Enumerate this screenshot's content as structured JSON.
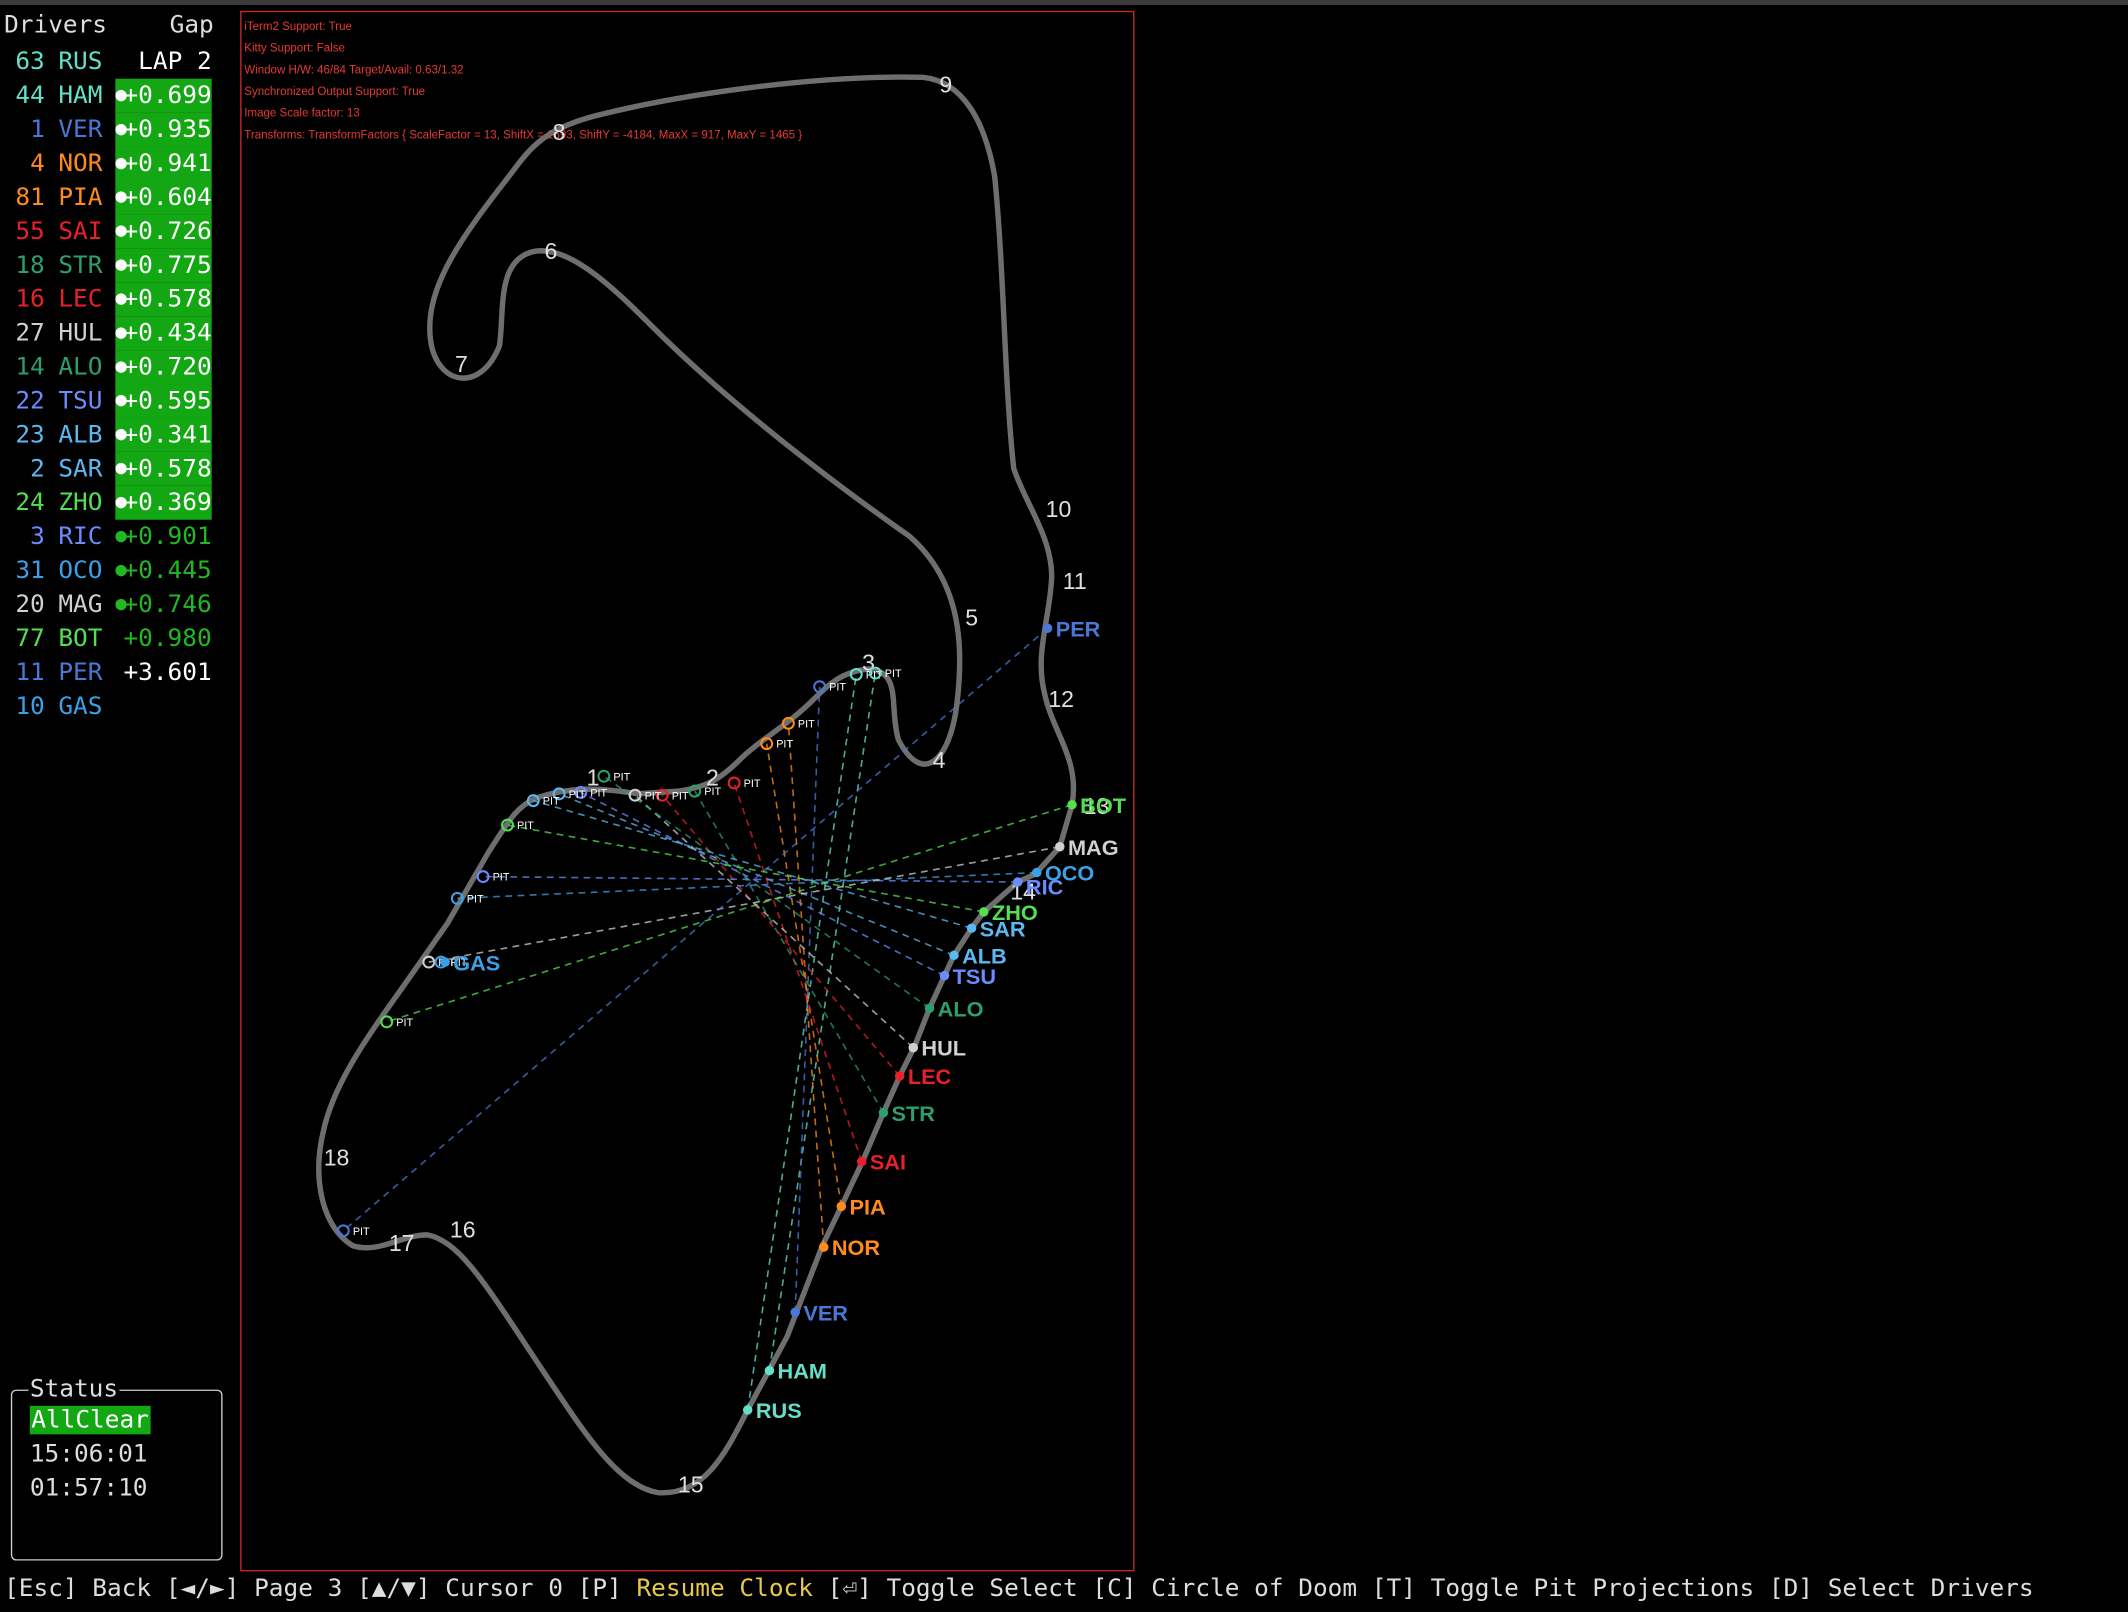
{
  "header": {
    "drivers": "Drivers",
    "gap": "Gap"
  },
  "drivers": [
    {
      "num": "63",
      "code": "RUS",
      "color": "#64e0c8",
      "gap": "LAP 2",
      "gap_style": "plain"
    },
    {
      "num": "44",
      "code": "HAM",
      "color": "#64e0c8",
      "gap": "+0.699",
      "gap_style": "green"
    },
    {
      "num": "1",
      "code": "VER",
      "color": "#4a78d6",
      "gap": "+0.935",
      "gap_style": "green"
    },
    {
      "num": "4",
      "code": "NOR",
      "color": "#ff8c1a",
      "gap": "+0.941",
      "gap_style": "green"
    },
    {
      "num": "81",
      "code": "PIA",
      "color": "#ff8c1a",
      "gap": "+0.604",
      "gap_style": "green"
    },
    {
      "num": "55",
      "code": "SAI",
      "color": "#e8202a",
      "gap": "+0.726",
      "gap_style": "green"
    },
    {
      "num": "18",
      "code": "STR",
      "color": "#2e9e6e",
      "gap": "+0.775",
      "gap_style": "green"
    },
    {
      "num": "16",
      "code": "LEC",
      "color": "#e8202a",
      "gap": "+0.578",
      "gap_style": "green"
    },
    {
      "num": "27",
      "code": "HUL",
      "color": "#d0d0d0",
      "gap": "+0.434",
      "gap_style": "green"
    },
    {
      "num": "14",
      "code": "ALO",
      "color": "#2e9e6e",
      "gap": "+0.720",
      "gap_style": "green"
    },
    {
      "num": "22",
      "code": "TSU",
      "color": "#6b8cff",
      "gap": "+0.595",
      "gap_style": "green"
    },
    {
      "num": "23",
      "code": "ALB",
      "color": "#5cb8f0",
      "gap": "+0.341",
      "gap_style": "green"
    },
    {
      "num": "2",
      "code": "SAR",
      "color": "#5cb8f0",
      "gap": "+0.578",
      "gap_style": "green"
    },
    {
      "num": "24",
      "code": "ZHO",
      "color": "#52e052",
      "gap": "+0.369",
      "gap_style": "green"
    },
    {
      "num": "3",
      "code": "RIC",
      "color": "#6b8cff",
      "gap": "+0.901",
      "gap_style": "dim"
    },
    {
      "num": "31",
      "code": "OCO",
      "color": "#3aa0e8",
      "gap": "+0.445",
      "gap_style": "dim"
    },
    {
      "num": "20",
      "code": "MAG",
      "color": "#d0d0d0",
      "gap": "+0.746",
      "gap_style": "dim"
    },
    {
      "num": "77",
      "code": "BOT",
      "color": "#52e052",
      "gap": "+0.980",
      "gap_style": "dimnodot"
    },
    {
      "num": "11",
      "code": "PER",
      "color": "#4a78d6",
      "gap": "+3.601",
      "gap_style": "plain"
    },
    {
      "num": "10",
      "code": "GAS",
      "color": "#3aa0e8",
      "gap": "",
      "gap_style": "plain"
    }
  ],
  "status": {
    "title": "Status",
    "state": "AllClear",
    "time1": "15:06:01",
    "time2": "01:57:10"
  },
  "debug_lines": [
    "iTerm2 Support: True",
    "Kitty Support: False",
    "Window H/W: 46/84 Target/Avail: 0.63/1.32",
    "Synchronized Output Support: True",
    "Image Scale factor: 13",
    "Transforms: TransformFactors { ScaleFactor = 13, ShiftX = 1693, ShiftY = -4184, MaxX = 917, MaxY = 1465 }"
  ],
  "map": {
    "track_color": "#6e6e6e",
    "pit_label": "PIT",
    "corners": [
      "1",
      "2",
      "3",
      "4",
      "5",
      "6",
      "7",
      "8",
      "9",
      "10",
      "11",
      "12",
      "13",
      "14",
      "15",
      "16",
      "17",
      "18"
    ],
    "cars": [
      {
        "code": "RUS",
        "color": "#64e0c8"
      },
      {
        "code": "HAM",
        "color": "#64e0c8"
      },
      {
        "code": "VER",
        "color": "#4a78d6"
      },
      {
        "code": "NOR",
        "color": "#ff8c1a"
      },
      {
        "code": "PIA",
        "color": "#ff8c1a"
      },
      {
        "code": "SAI",
        "color": "#e8202a"
      },
      {
        "code": "STR",
        "color": "#2e9e6e"
      },
      {
        "code": "LEC",
        "color": "#e8202a"
      },
      {
        "code": "HUL",
        "color": "#d0d0d0"
      },
      {
        "code": "ALO",
        "color": "#2e9e6e"
      },
      {
        "code": "TSU",
        "color": "#6b8cff"
      },
      {
        "code": "ALB",
        "color": "#5cb8f0"
      },
      {
        "code": "SAR",
        "color": "#5cb8f0"
      },
      {
        "code": "ZHO",
        "color": "#52e052"
      },
      {
        "code": "RIC",
        "color": "#6b8cff"
      },
      {
        "code": "OCO",
        "color": "#3aa0e8"
      },
      {
        "code": "MAG",
        "color": "#d0d0d0"
      },
      {
        "code": "BOT",
        "color": "#52e052"
      },
      {
        "code": "PER",
        "color": "#4a78d6"
      },
      {
        "code": "GAS",
        "color": "#3aa0e8"
      }
    ]
  },
  "footer": [
    {
      "text": "[Esc] Back ",
      "color": "#dddddd"
    },
    {
      "text": "[◄/►] Page 3 ",
      "color": "#dddddd"
    },
    {
      "text": "[▲/▼] Cursor 0 ",
      "color": "#dddddd"
    },
    {
      "text": "[P] ",
      "color": "#dddddd"
    },
    {
      "text": "Resume Clock ",
      "color": "#e6c84a"
    },
    {
      "text": "[⏎] Toggle Select ",
      "color": "#dddddd"
    },
    {
      "text": "[C] Circle of Doom ",
      "color": "#dddddd"
    },
    {
      "text": "[T] Toggle Pit Projections ",
      "color": "#dddddd"
    },
    {
      "text": "[D] Select Drivers",
      "color": "#dddddd"
    }
  ]
}
